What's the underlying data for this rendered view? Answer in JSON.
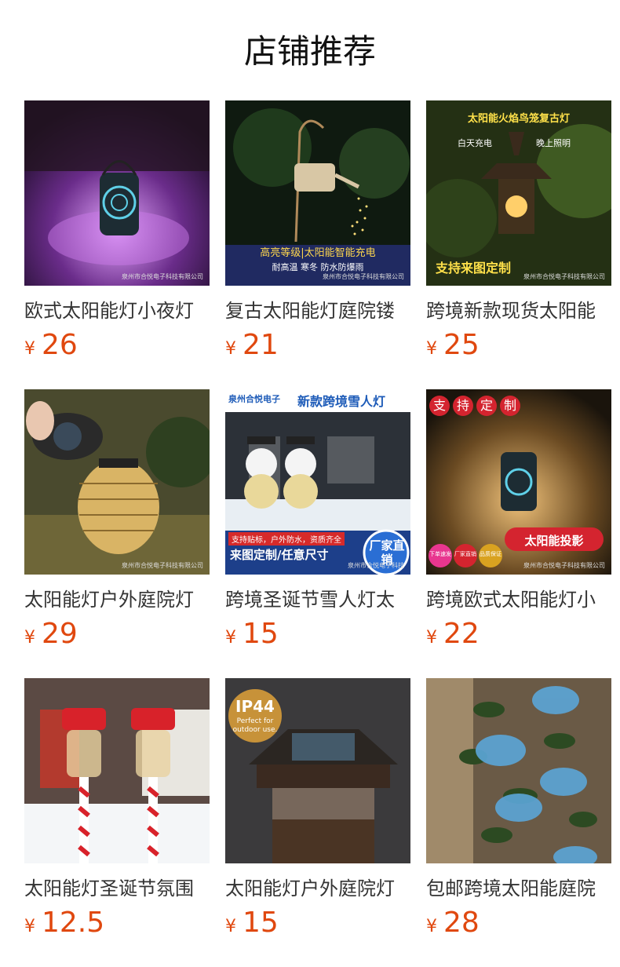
{
  "header": {
    "title": "店铺推荐"
  },
  "currency": "¥",
  "products": [
    {
      "name": "欧式太阳能灯小夜灯",
      "price": "26",
      "watermark": "泉州市合悦电子科技有限公司",
      "overlay_texts": []
    },
    {
      "name": "复古太阳能灯庭院镂",
      "price": "21",
      "watermark": "泉州市合悦电子科技有限公司",
      "overlay_texts": [
        "高亮等级|太阳能智能充电",
        "耐高温  寒冬  防水防爆雨"
      ]
    },
    {
      "name": "跨境新款现货太阳能",
      "price": "25",
      "watermark": "泉州市合悦电子科技有限公司",
      "overlay_texts": [
        "太阳能火焰鸟笼复古灯",
        "白天充电",
        "晚上照明",
        "支持来图定制"
      ]
    },
    {
      "name": "太阳能灯户外庭院灯",
      "price": "29",
      "watermark": "泉州市合悦电子科技有限公司",
      "overlay_texts": []
    },
    {
      "name": "跨境圣诞节雪人灯太",
      "price": "15",
      "watermark": "泉州市合悦电子科技",
      "overlay_texts": [
        "泉州合悦电子",
        "新款跨境雪人灯",
        "支持贴标，户外防水，资质齐全",
        "来图定制/任意尺寸",
        "厂家直销"
      ]
    },
    {
      "name": "跨境欧式太阳能灯小",
      "price": "22",
      "watermark": "泉州市合悦电子科技有限公司",
      "overlay_texts": [
        "支",
        "持",
        "定",
        "制",
        "太阳能投影",
        "下单速发",
        "厂家直销",
        "品质保证"
      ]
    },
    {
      "name": "太阳能灯圣诞节氛围",
      "price": "12.5",
      "watermark": "",
      "overlay_texts": []
    },
    {
      "name": "太阳能灯户外庭院灯",
      "price": "15",
      "watermark": "",
      "overlay_texts": [
        "IP44",
        "Perfect for outdoor use."
      ]
    },
    {
      "name": "包邮跨境太阳能庭院",
      "price": "28",
      "watermark": "",
      "overlay_texts": []
    }
  ]
}
